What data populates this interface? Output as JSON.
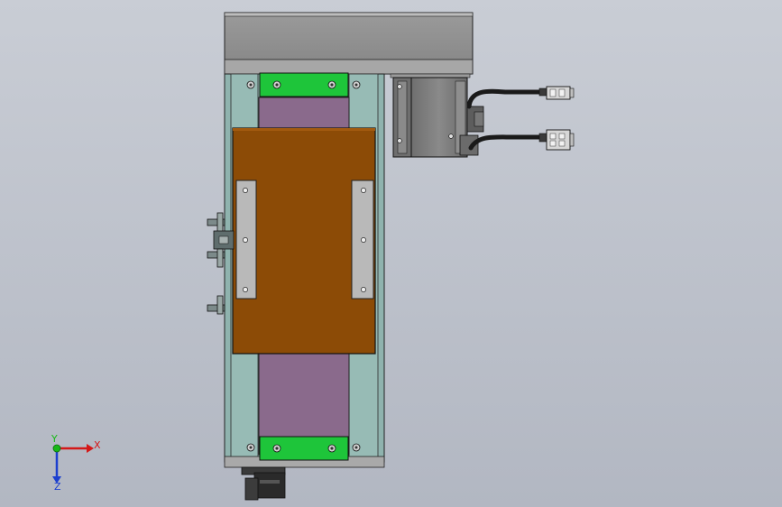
{
  "viewport": {
    "colors": {
      "background_top": "#c8ccd4",
      "background_bottom": "#b3b8c3",
      "rail": "#8fb3ae",
      "belt": "#8a6a8c",
      "carriage": "#8c4b06",
      "end_block": "#1ec53a",
      "housing": "#8f8f8f",
      "bracket": "#b9b9b9",
      "motor": "#7b7b7b"
    }
  },
  "triad": {
    "x_label": "X",
    "y_label": "Y",
    "z_label": "Z",
    "x_color": "#d41818",
    "y_color": "#18b818",
    "z_color": "#1c3fcf"
  }
}
